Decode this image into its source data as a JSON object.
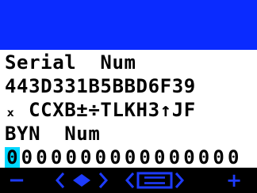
{
  "colors": {
    "title_bar": "#0a2bff",
    "screen_bg": "#ffffff",
    "cursor": "#00d7ff",
    "softkey": "#1e3cff"
  },
  "screen": {
    "line1": "Serial  Num",
    "line2": "443D331B5BBD6F39",
    "line3": "ₓ CCXB±÷TLKH3↑JF",
    "line4": "BYN  Num",
    "line5_cursor": "0",
    "line5_rest": [
      "0",
      "0",
      "0",
      "0",
      "0",
      "0",
      "0",
      "0",
      "0",
      "0",
      "0",
      "0",
      "0",
      "0",
      "0"
    ]
  },
  "softkeys": {
    "minus": "−",
    "nav_icon": "left-right-arrows-icon",
    "menu_icon": "menu-list-icon",
    "plus": "+"
  }
}
